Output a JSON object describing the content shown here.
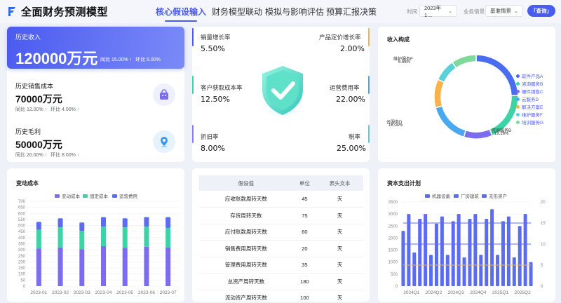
{
  "header": {
    "title": "全面财务预测模型",
    "tabs": [
      "核心假设输入",
      "财务模型联动",
      "模拟与影响评估",
      "预算汇报决策"
    ],
    "active_tab": 0,
    "time_label": "时间",
    "time_value": "2023年1…",
    "scenario_label": "业务情景",
    "scenario_value": "基准情景",
    "query_label": "「查询」"
  },
  "colors": {
    "accent": "#4a5bf0",
    "green": "#2bbf6a",
    "teal": "#3ed3a6",
    "purple": "#8b7bf0"
  },
  "history": {
    "revenue": {
      "label": "历史收入",
      "value": "120000万元",
      "yoy": "同比 15.00%",
      "mom": "环比 5.00%"
    },
    "cost": {
      "label": "历史销售成本",
      "value": "70000万元",
      "yoy": "同比 12.00%",
      "mom": "环比 4.00%",
      "icon": "bag-icon"
    },
    "profit": {
      "label": "历史毛利",
      "value": "50000万元",
      "yoy": "同比 20.00%",
      "mom": "环比 8.00%",
      "icon": "location-pin-icon"
    }
  },
  "kpis": [
    {
      "label": "销量增长率",
      "value": "5.50%"
    },
    {
      "label": "产品定价增长率",
      "value": "2.00%"
    },
    {
      "label": "客户获取成本率",
      "value": "12.50%"
    },
    {
      "label": "运营费用率",
      "value": "22.00%"
    },
    {
      "label": "折旧率",
      "value": "8.00%"
    },
    {
      "label": "税率",
      "value": "25.00%"
    }
  ],
  "pie": {
    "title": "收入构成",
    "callouts": [
      {
        "name": "维护服务F",
        "pct": "8.56%"
      },
      {
        "name": "云服务D",
        "pct": "16.04%"
      },
      {
        "name": "咨询服务B",
        "pct": "19.26%"
      }
    ],
    "legend": [
      "软件产品A",
      "咨询服务B",
      "硬件销售C",
      "云服务D",
      "解决方案E",
      "维护服务F",
      "培训服务G"
    ]
  },
  "chart_data": [
    {
      "type": "pie",
      "title": "收入构成",
      "slices": [
        {
          "name": "软件产品A",
          "value": 24.5,
          "color": "#4a6cf0"
        },
        {
          "name": "咨询服务B",
          "value": 19.26,
          "color": "#3ed3a6"
        },
        {
          "name": "硬件销售C",
          "value": 11.0,
          "color": "#7b6cf0"
        },
        {
          "name": "云服务D",
          "value": 16.04,
          "color": "#4aa8f0"
        },
        {
          "name": "解决方案E",
          "value": 11.0,
          "color": "#f7b34a"
        },
        {
          "name": "维护服务F",
          "value": 8.56,
          "color": "#5ad0d8"
        },
        {
          "name": "培训服务G",
          "value": 9.64,
          "color": "#7ed99a"
        }
      ]
    },
    {
      "type": "bar",
      "title": "变动成本",
      "stacked": true,
      "categories": [
        "2023-01",
        "2023-02",
        "2023-03",
        "2023-04",
        "2023-05",
        "2023-06",
        "2023-07"
      ],
      "series": [
        {
          "name": "变动成本",
          "values": [
            310,
            320,
            305,
            330,
            315,
            325,
            320
          ],
          "color": "#7b6cf0"
        },
        {
          "name": "固定成本",
          "values": [
            155,
            165,
            150,
            160,
            170,
            165,
            160
          ],
          "color": "#3ed3a6"
        },
        {
          "name": "运营费用",
          "values": [
            65,
            75,
            70,
            80,
            75,
            80,
            90
          ],
          "color": "#5b6cf2"
        }
      ],
      "yticks": [
        0,
        50,
        100,
        150,
        200,
        250,
        300,
        350,
        400,
        450,
        500,
        550,
        600,
        650,
        700
      ],
      "ylim": [
        0,
        700
      ]
    },
    {
      "type": "bar",
      "title": "资本支出计划",
      "categories": [
        "2024Q1",
        "2024Q2",
        "2024Q3",
        "2024Q4",
        "2025Q1",
        "2025Q2"
      ],
      "series": [
        {
          "name": "机器设备",
          "values": [
            2300,
            3000,
            1400,
            2800,
            3000,
            1300,
            2600,
            2900,
            1300,
            2700,
            3000,
            1200,
            2800,
            3000,
            1300,
            2800,
            3200,
            1300,
            2700,
            2900,
            1200,
            2500,
            3000,
            1000
          ],
          "color": "#5b6cf2"
        },
        {
          "name": "厂房建筑",
          "line_y2": [
            15,
            15,
            15,
            15,
            15,
            15,
            15,
            15,
            15,
            15,
            15,
            15,
            15,
            15,
            15,
            15,
            15,
            15,
            15,
            15,
            15,
            15,
            15,
            15
          ],
          "color": "#5b6cf2"
        },
        {
          "name": "无形资产",
          "line_y2": [
            10,
            10,
            10,
            10,
            10,
            10,
            10,
            10,
            10,
            10,
            10,
            10,
            10,
            10,
            10,
            10,
            10,
            10,
            10,
            10,
            10,
            10,
            10,
            10
          ],
          "line2_y2": [
            5,
            5,
            5,
            5,
            5,
            5,
            5,
            5,
            5,
            5,
            5,
            5,
            5,
            5,
            5,
            5,
            5,
            5,
            5,
            5,
            5,
            5,
            5,
            5
          ],
          "color": "#f7b34a"
        }
      ],
      "yticks": [
        0,
        500,
        1000,
        1500,
        2000,
        2500,
        3000,
        3500
      ],
      "y2ticks": [
        0,
        5,
        10,
        15,
        20
      ],
      "ylim": [
        0,
        3500
      ],
      "y2lim": [
        0,
        20
      ]
    }
  ],
  "stack_chart": {
    "title": "变动成本",
    "legend": [
      "变动成本",
      "固定成本",
      "运营费用"
    ]
  },
  "capex_chart": {
    "title": "资本支出计划",
    "legend": [
      "机器设备",
      "厂房建筑",
      "无形资产"
    ]
  },
  "table": {
    "headers": [
      "假设值",
      "单位",
      "表头文本"
    ],
    "rows": [
      [
        "应收账款周转天数",
        "45",
        "天"
      ],
      [
        "存货周转天数",
        "75",
        "天"
      ],
      [
        "应付账款周转天数",
        "60",
        "天"
      ],
      [
        "销售费用周转天数",
        "20",
        "天"
      ],
      [
        "管理费用周转天数",
        "35",
        "天"
      ],
      [
        "总资产周转天数",
        "180",
        "天"
      ],
      [
        "流动资产周转天数",
        "100",
        "天"
      ]
    ]
  }
}
